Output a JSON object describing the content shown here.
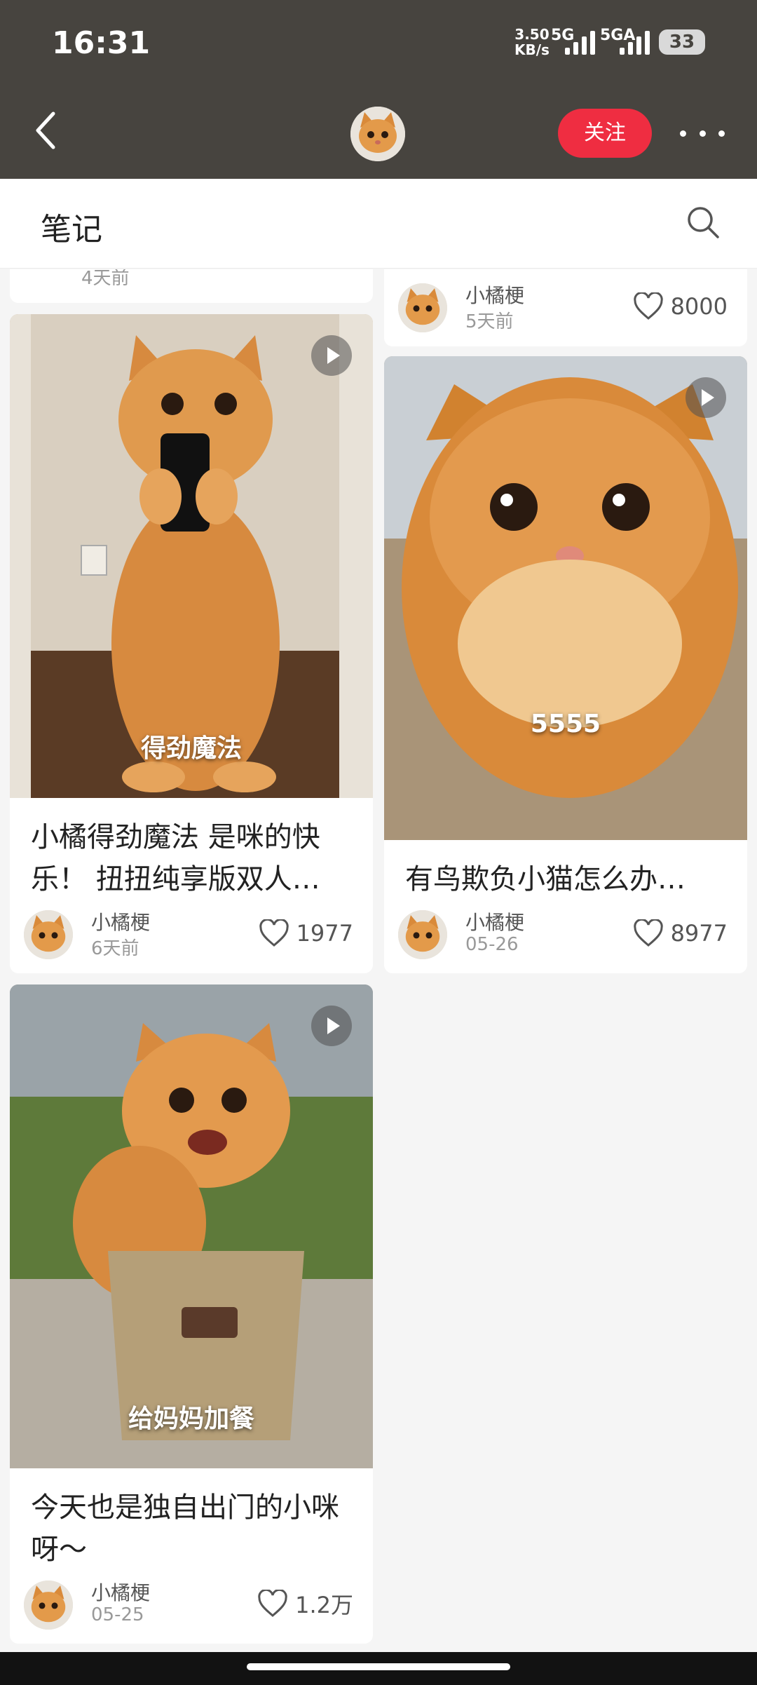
{
  "status_bar": {
    "time": "16:31",
    "speed_value": "3.50",
    "speed_unit": "KB/s",
    "net1": "5G",
    "net2": "5GA",
    "battery": "33"
  },
  "top_bar": {
    "follow_label": "关注"
  },
  "section": {
    "title": "笔记"
  },
  "feed": {
    "top_left_partial": {
      "time": "4天前"
    },
    "top_right_partial": {
      "author": "小橘梗",
      "time": "5天前",
      "likes": "8000"
    },
    "cards": [
      {
        "caption": "得劲魔法",
        "title": "小橘得劲魔法 是咪的快乐！ 扭扭纯享版双人…",
        "author": "小橘梗",
        "time": "6天前",
        "likes": "1977"
      },
      {
        "caption": "5555",
        "title": "有鸟欺负小猫怎么办…",
        "author": "小橘梗",
        "time": "05-26",
        "likes": "8977"
      },
      {
        "caption": "给妈妈加餐",
        "title": "今天也是独自出门的小咪呀～",
        "author": "小橘梗",
        "time": "05-25",
        "likes": "1.2万"
      }
    ]
  },
  "colors": {
    "header_bg": "#47443f",
    "accent": "#ef2d41",
    "cat_orange": "#d98a3a"
  },
  "icons": [
    "back-icon",
    "more-icon",
    "search-icon",
    "heart-icon",
    "play-icon"
  ]
}
